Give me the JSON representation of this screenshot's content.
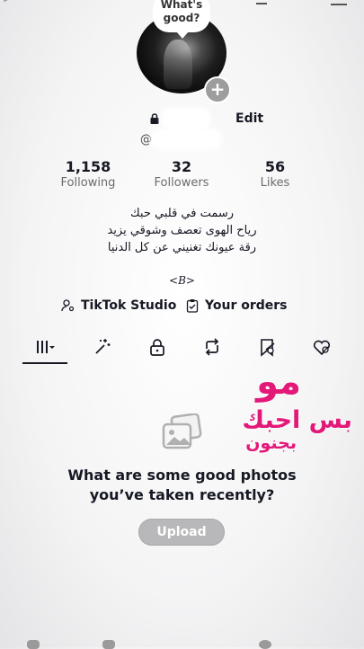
{
  "bubble": {
    "text": "What's good?"
  },
  "profile": {
    "edit_label": "Edit",
    "at_symbol": "@",
    "add_icon": "plus-icon"
  },
  "stats": [
    {
      "value": "1,158",
      "label": "Following"
    },
    {
      "value": "32",
      "label": "Followers"
    },
    {
      "value": "56",
      "label": "Likes"
    }
  ],
  "bio": {
    "lines": [
      "رسمت في قلبي حبك",
      "رياح الهوى تعصف وشوقي يزيد",
      "رقة عيونك تغنيني عن كل الدنيا"
    ],
    "tag": "<B>"
  },
  "links": {
    "studio": "TikTok Studio",
    "orders": "Your orders"
  },
  "tabs": [
    {
      "icon": "grid-menu-icon"
    },
    {
      "icon": "sparkle-wand-icon"
    },
    {
      "icon": "lock-icon"
    },
    {
      "icon": "repost-icon"
    },
    {
      "icon": "bookmark-hidden-icon"
    },
    {
      "icon": "liked-hidden-icon"
    }
  ],
  "empty_state": {
    "title_line1": "What are some good photos",
    "title_line2": "you’ve taken recently?",
    "upload_label": "Upload"
  },
  "sticker": {
    "line1": "مو",
    "line2": "بس احبك",
    "line3": "بجنون"
  },
  "colors": {
    "accent_pink": "#e3197a",
    "text": "#161823",
    "muted": "#6b6b6b"
  }
}
